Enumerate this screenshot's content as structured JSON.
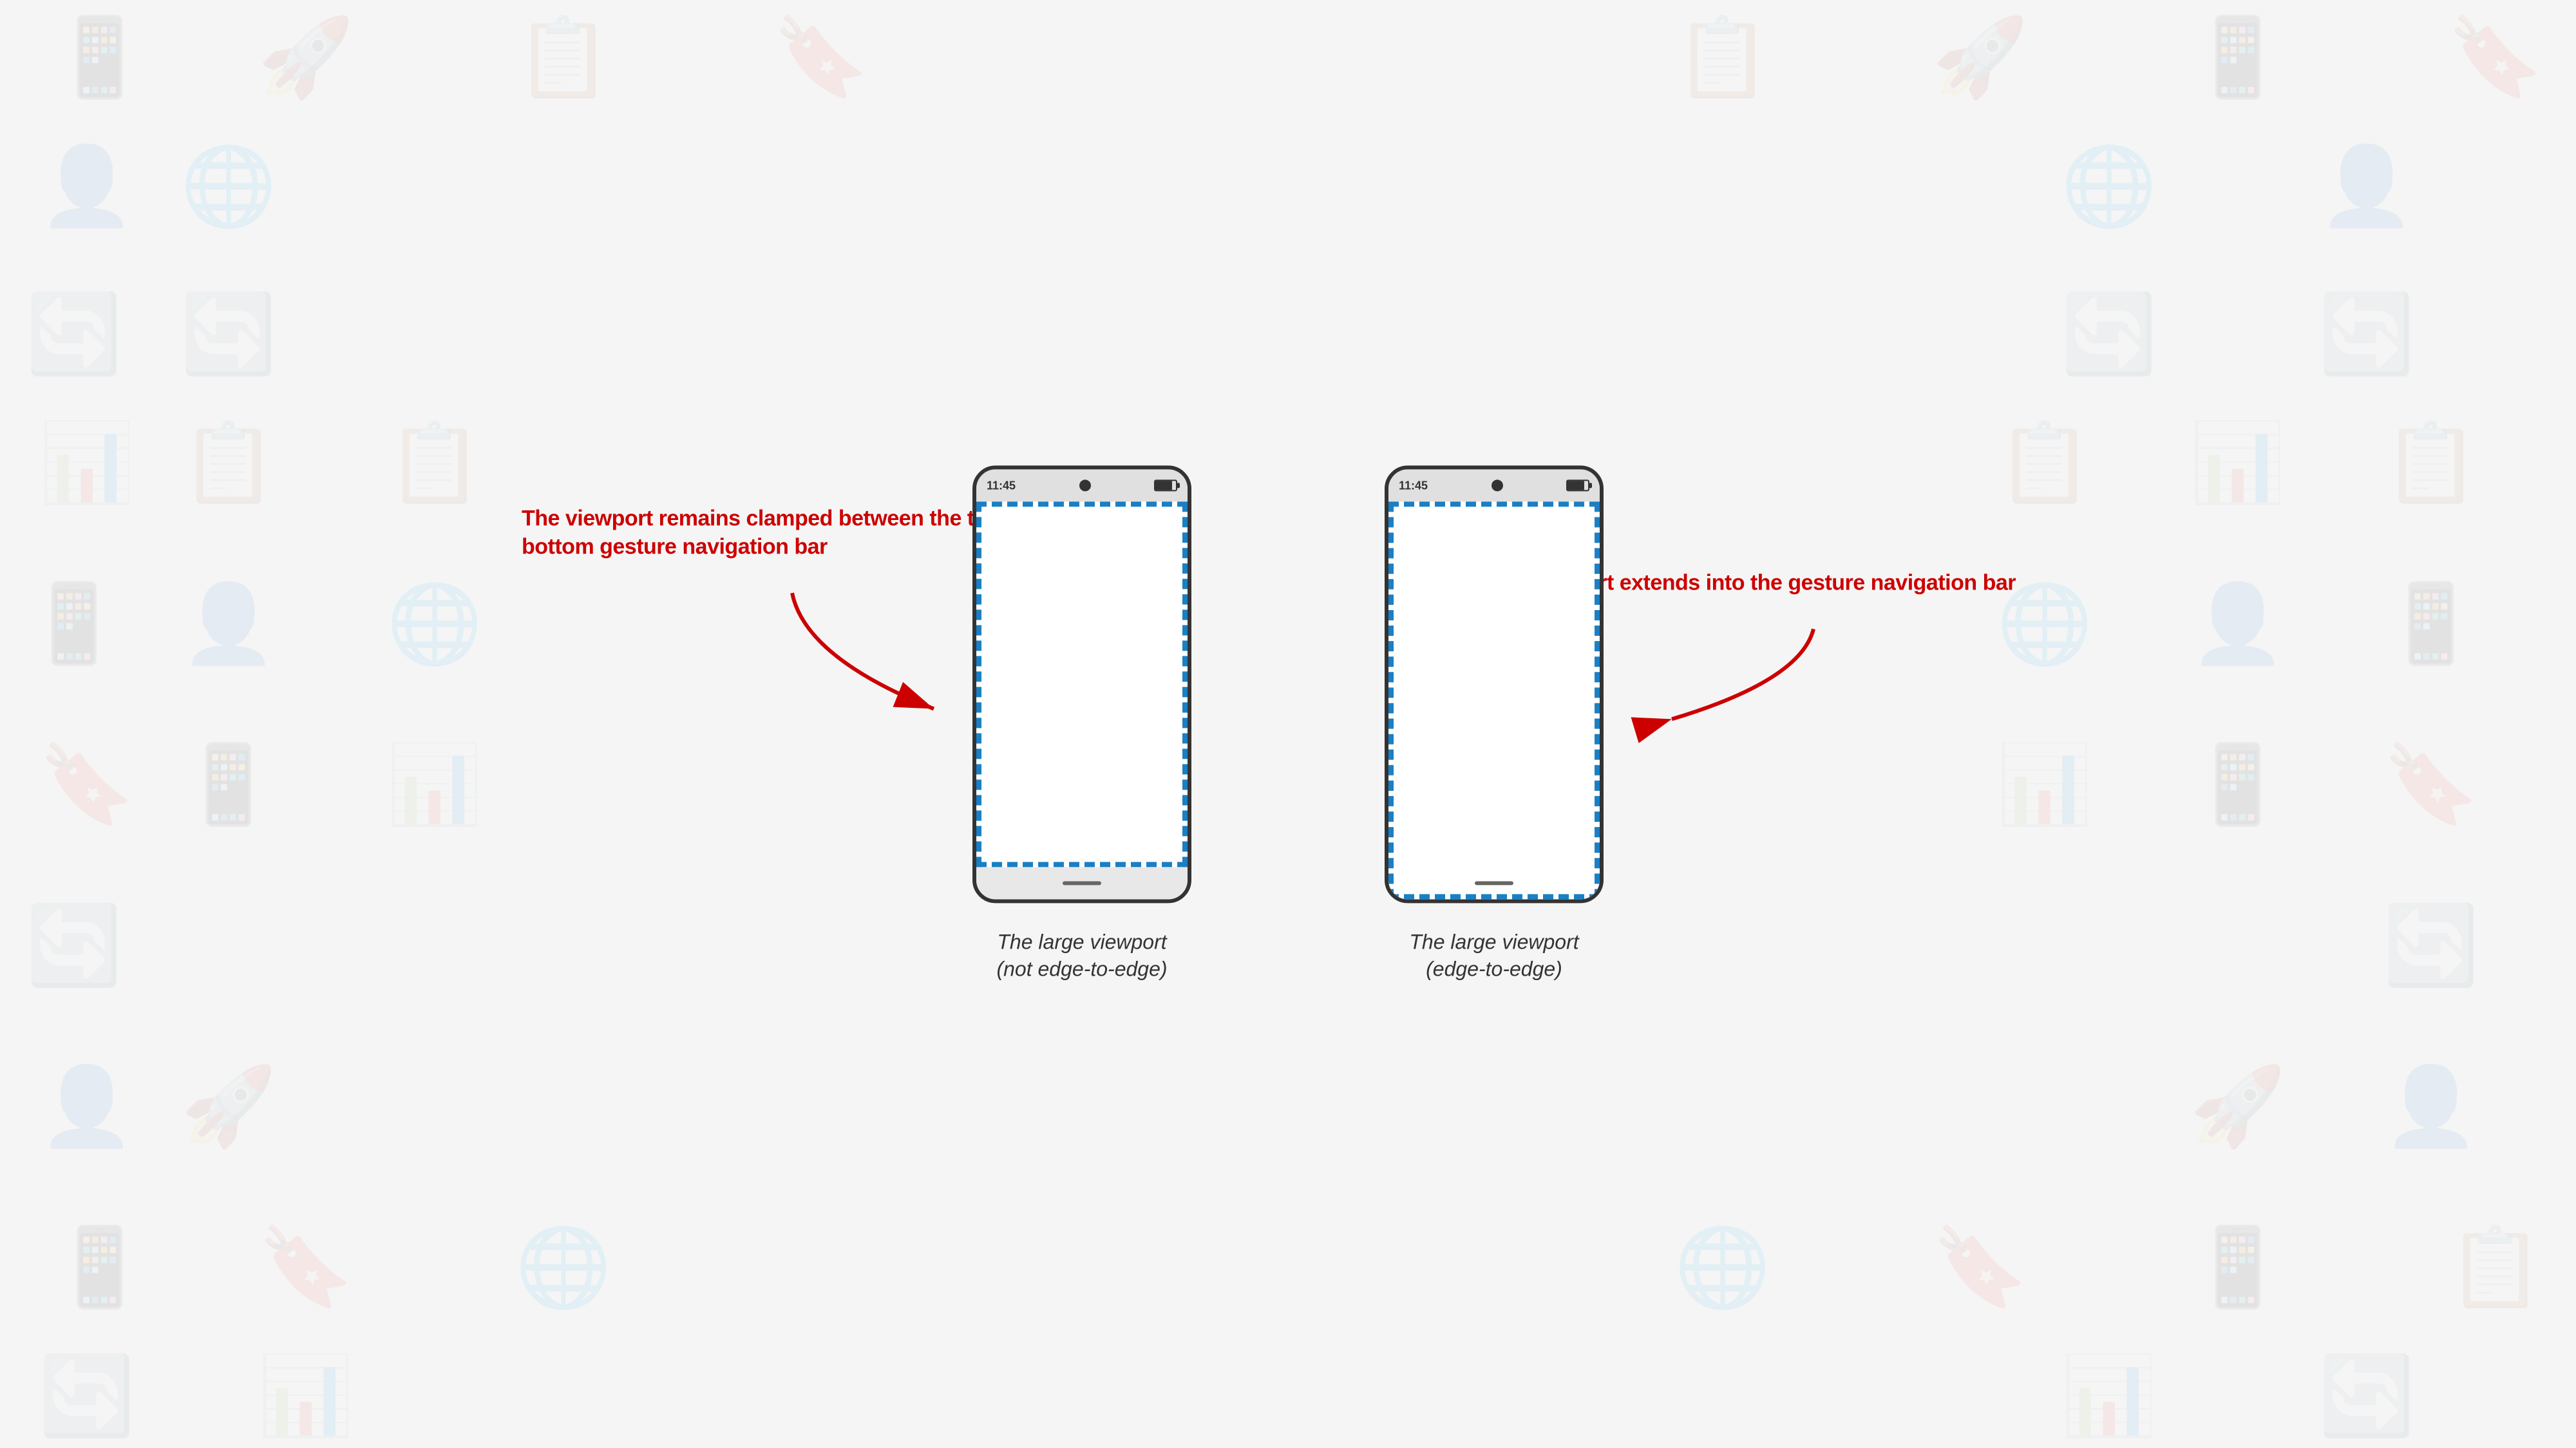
{
  "background": {
    "color": "#f5f5f5"
  },
  "phones": [
    {
      "id": "not-edge-to-edge",
      "status_bar": {
        "time": "11:45"
      },
      "caption_line1": "The large viewport",
      "caption_line2": "(not edge-to-edge)",
      "viewport_type": "clamped"
    },
    {
      "id": "edge-to-edge",
      "status_bar": {
        "time": "11:45"
      },
      "caption_line1": "The large viewport",
      "caption_line2": "(edge-to-edge)",
      "viewport_type": "edge"
    }
  ],
  "annotations": [
    {
      "id": "left-annotation",
      "text": "The viewport remains clamped between the top status bar and bottom gesture navigation bar",
      "color": "#cc0000"
    },
    {
      "id": "right-annotation",
      "text": "The viewport extends into the gesture navigation bar",
      "color": "#cc0000"
    }
  ]
}
